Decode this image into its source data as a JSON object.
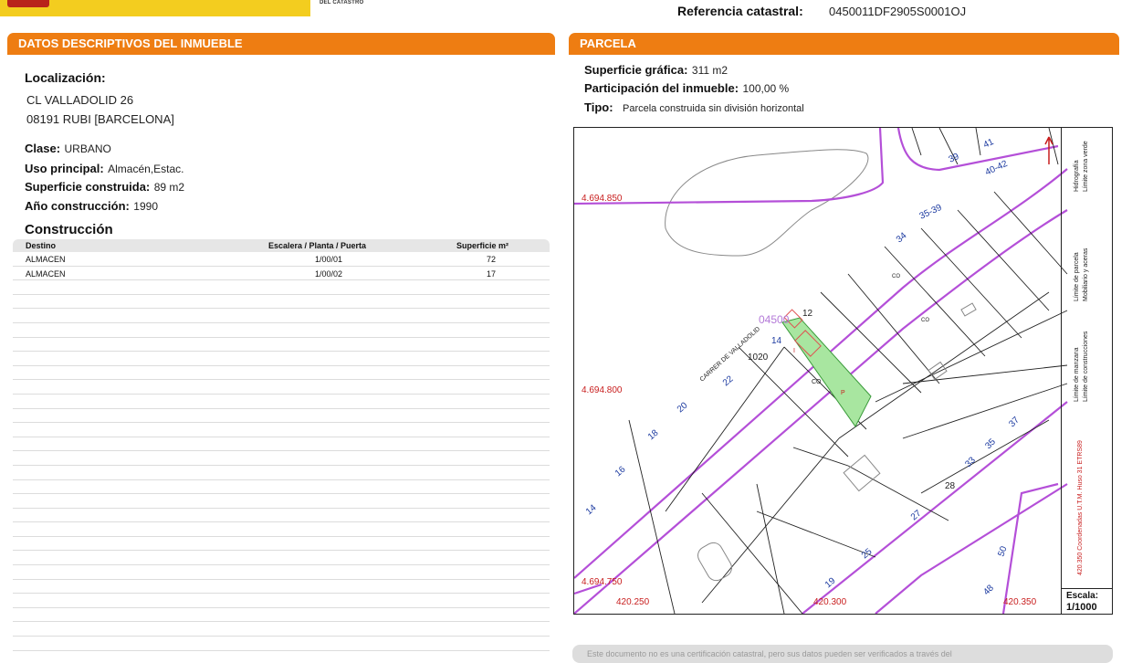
{
  "header": {
    "logo_sub": "DEL CATASTRO",
    "ref_label": "Referencia catastral:",
    "ref_value": "0450011DF2905S0001OJ",
    "colors": {
      "accent": "#ee7d12",
      "logo_yellow": "#f3cd1f",
      "logo_red": "#b8231b"
    }
  },
  "left": {
    "section_title_prefix": "DATOS DESCRIPTIVOS DEL ",
    "section_title_strong": "INMUEBLE",
    "localizacion_label": "Localización:",
    "address_line1": "CL VALLADOLID 26",
    "address_line2": "08191 RUBI [BARCELONA]",
    "clase_label": "Clase:",
    "clase_value": "URBANO",
    "uso_label": "Uso principal:",
    "uso_value": "Almacén,Estac.",
    "superficie_label": "Superficie construida:",
    "superficie_value": "89 m2",
    "anio_label": "Año construcción:",
    "anio_value": "1990",
    "construccion_title": "Construcción",
    "table": {
      "headers": [
        "Destino",
        "Escalera / Planta / Puerta",
        "Superficie m²"
      ],
      "rows": [
        [
          "ALMACEN",
          "1/00/01",
          "72"
        ],
        [
          "ALMACEN",
          "1/00/02",
          "17"
        ]
      ]
    }
  },
  "right": {
    "section_title": "PARCELA",
    "superficie_grafica_label": "Superficie gráfica:",
    "superficie_grafica_value": "311 m2",
    "participacion_label": "Participación del inmueble:",
    "participacion_value": "100,00 %",
    "tipo_label": "Tipo:",
    "tipo_value": "Parcela construida sin división horizontal"
  },
  "map": {
    "y_coords": [
      "4.694.850",
      "4.694.800",
      "4.694.750"
    ],
    "x_coords": [
      "420.250",
      "420.300",
      "420.350"
    ],
    "street_label": "CARRER DE VALLADOLID",
    "parcel_ref": "04500",
    "numbers": [
      "12",
      "14",
      "1020",
      "22",
      "20",
      "18",
      "16",
      "14",
      "34",
      "35-39",
      "40-42",
      "41",
      "39",
      "37",
      "35",
      "33",
      "28",
      "27",
      "25",
      "19",
      "48",
      "50"
    ],
    "parcel_marks": [
      "I",
      "CO",
      "P"
    ],
    "other_marks": [
      "CO",
      "CO"
    ],
    "scale_label": "Escala:",
    "scale_value": "1/1000",
    "legend": {
      "col1": [
        "Límite de manzana",
        "Límite de parcela",
        "Hidrografía"
      ],
      "col2": [
        "Límite de construcciones",
        "Mobiliario y aceras",
        "Límite zona verde"
      ],
      "coords_note": "420.350 Coordenadas U.T.M. Huso 31 ETRS89"
    },
    "colors": {
      "block": "#b44fd8",
      "parcel_fill": "#a8e6a0",
      "parcel_line": "#e05050"
    }
  },
  "note_text": "Este documento no es una certificación catastral, pero sus datos pueden ser verificados a través del"
}
